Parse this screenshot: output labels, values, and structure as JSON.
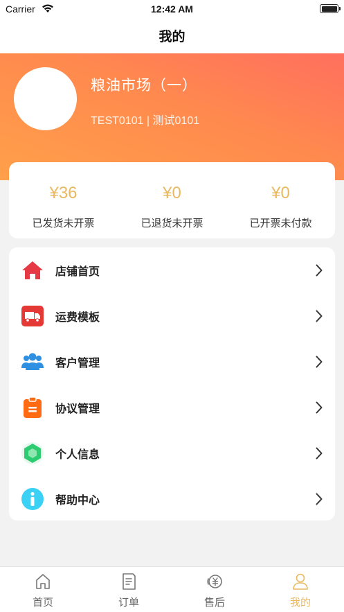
{
  "status_bar": {
    "carrier": "Carrier",
    "time": "12:42 AM"
  },
  "nav": {
    "title": "我的"
  },
  "profile": {
    "store_name": "粮油市场（一）",
    "store_code": "TEST0101 | 测试0101"
  },
  "stats": [
    {
      "value": "¥36",
      "label": "已发货未开票"
    },
    {
      "value": "¥0",
      "label": "已退货未开票"
    },
    {
      "value": "¥0",
      "label": "已开票未付款"
    }
  ],
  "menu": [
    {
      "label": "店铺首页",
      "icon": "home-icon",
      "color": "#e63946"
    },
    {
      "label": "运费模板",
      "icon": "truck-icon",
      "color": "#e53935"
    },
    {
      "label": "客户管理",
      "icon": "users-icon",
      "color": "#2f8fe0"
    },
    {
      "label": "协议管理",
      "icon": "clipboard-icon",
      "color": "#ff6a13"
    },
    {
      "label": "个人信息",
      "icon": "hexagon-icon",
      "color": "#2ecc71"
    },
    {
      "label": "帮助中心",
      "icon": "info-icon",
      "color": "#3ad1f5"
    }
  ],
  "tabs": [
    {
      "label": "首页",
      "icon": "home-outline-icon"
    },
    {
      "label": "订单",
      "icon": "order-icon"
    },
    {
      "label": "售后",
      "icon": "after-sale-icon"
    },
    {
      "label": "我的",
      "icon": "profile-icon",
      "active": true
    }
  ],
  "colors": {
    "accent": "#e9b860",
    "gradient_start": "#ffa04a",
    "gradient_end": "#ff6f5e"
  }
}
